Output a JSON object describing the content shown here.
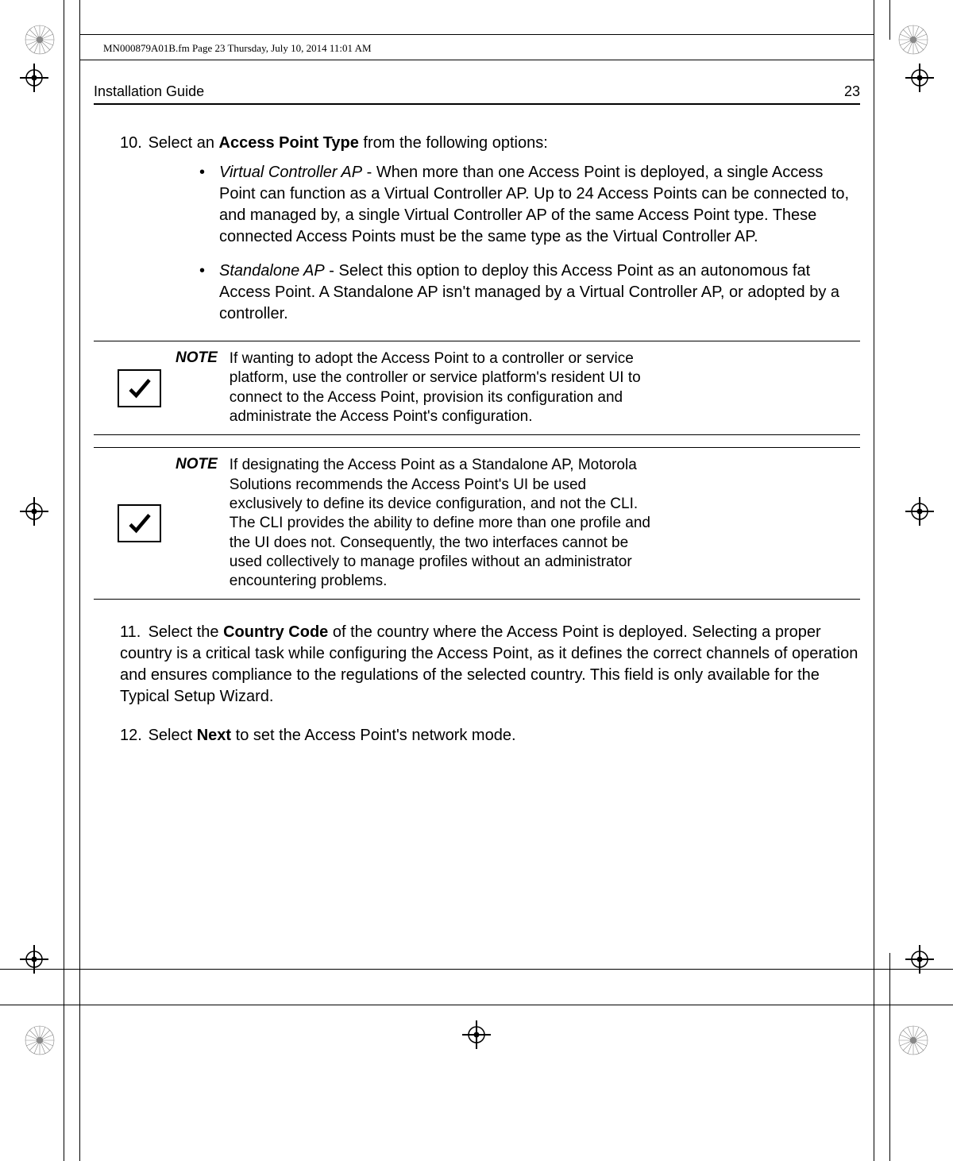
{
  "file_header": "MN000879A01B.fm  Page 23  Thursday, July 10, 2014  11:01 AM",
  "running_header": {
    "title": "Installation Guide",
    "page": "23"
  },
  "step10": {
    "number": "10.",
    "prefix": "Select an ",
    "bold": "Access Point Type",
    "suffix": " from the following options:",
    "bullets": [
      {
        "label": "Virtual Controller AP",
        "text": " - When more than one Access Point is deployed, a single Access Point can function as a Virtual Controller AP. Up to 24 Access Points can be connected to, and managed by, a single Virtual Controller AP of the same Access Point type. These connected Access Points must be the same type as the Virtual Controller AP."
      },
      {
        "label": "Standalone AP",
        "text": " - Select this option to deploy this Access Point as an autonomous fat Access Point. A Standalone AP isn't managed by a Virtual Controller AP, or adopted by a controller."
      }
    ]
  },
  "note1": {
    "label": "NOTE",
    "text": "If wanting to adopt the Access Point to a controller or service platform, use the controller or service platform's resident UI to connect to the Access Point, provision its configuration and administrate the Access Point's configuration."
  },
  "note2": {
    "label": "NOTE",
    "text": "If designating the Access Point as a Standalone AP, Motorola Solutions recommends the Access Point's UI be used exclusively to define its device configuration, and not the CLI. The CLI provides the ability to define more than one profile and the UI does not. Consequently, the two interfaces cannot be used collectively to manage profiles without an administrator encountering problems."
  },
  "step11": {
    "number": "11.",
    "prefix": "Select the ",
    "bold": "Country Code",
    "suffix": " of the country where the Access Point is deployed. Selecting a proper country is a critical task while configuring the Access Point, as it defines the correct channels of operation and ensures compliance to the regulations of the selected country. This field is only available for the Typical Setup Wizard."
  },
  "step12": {
    "number": "12.",
    "prefix": "Select ",
    "bold": "Next",
    "suffix": " to set the Access Point's network mode."
  }
}
